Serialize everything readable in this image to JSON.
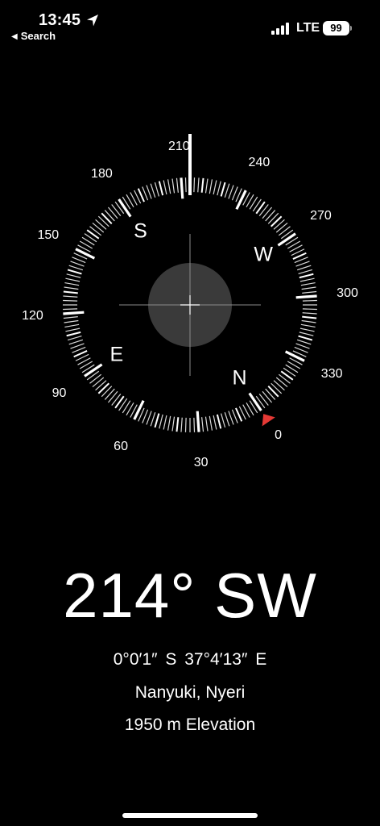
{
  "status_bar": {
    "time": "13:45",
    "location_icon": "location-arrow-icon",
    "back_label": "Search",
    "network": "LTE",
    "battery": "99"
  },
  "compass": {
    "heading_deg": 214,
    "needle_color": "#e53935",
    "bezel_labels": [
      {
        "text": "0",
        "deg": 0
      },
      {
        "text": "30",
        "deg": 30
      },
      {
        "text": "60",
        "deg": 60
      },
      {
        "text": "90",
        "deg": 90
      },
      {
        "text": "120",
        "deg": 120
      },
      {
        "text": "150",
        "deg": 150
      },
      {
        "text": "180",
        "deg": 180
      },
      {
        "text": "210",
        "deg": 210
      },
      {
        "text": "240",
        "deg": 240
      },
      {
        "text": "270",
        "deg": 270
      },
      {
        "text": "300",
        "deg": 300
      },
      {
        "text": "330",
        "deg": 330
      }
    ],
    "cardinals": [
      {
        "text": "N",
        "deg": 0
      },
      {
        "text": "E",
        "deg": 90
      },
      {
        "text": "S",
        "deg": 180
      },
      {
        "text": "W",
        "deg": 270
      }
    ]
  },
  "readout": {
    "heading": "214° SW",
    "coordinates": "0°0′1″ S  37°4′13″ E",
    "place": "Nanyuki, Nyeri",
    "elevation": "1950 m Elevation"
  }
}
